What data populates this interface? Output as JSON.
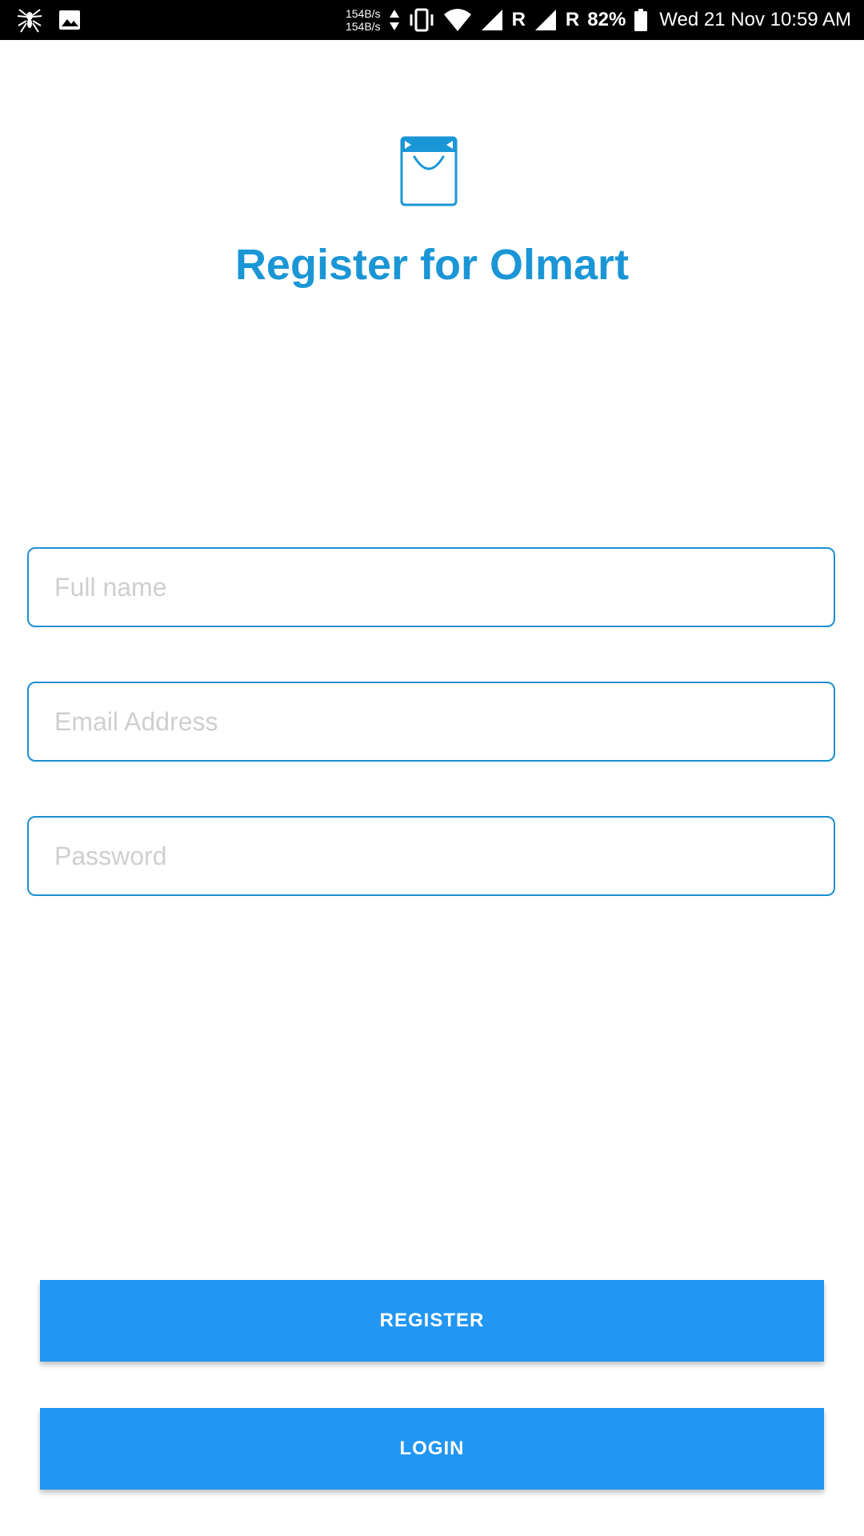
{
  "status_bar": {
    "net_up": "154B/s",
    "net_down": "154B/s",
    "roaming_1": "R",
    "roaming_2": "R",
    "battery": "82%",
    "datetime": "Wed 21 Nov 10:59 AM",
    "icons": [
      "spider-app-icon",
      "image-icon",
      "data-arrows-icon",
      "vibrate-icon",
      "wifi-icon",
      "signal-icon",
      "signal-icon",
      "battery-icon"
    ]
  },
  "header": {
    "title": "Register for Olmart",
    "logo_icon": "shopping-bag-icon"
  },
  "form": {
    "fullname_placeholder": "Full name",
    "email_placeholder": "Email Address",
    "password_placeholder": "Password"
  },
  "actions": {
    "register_label": "REGISTER",
    "login_label": "LOGIN"
  },
  "colors": {
    "accent": "#1a96d6",
    "field_border": "#1a8fd3",
    "button": "#2196f3",
    "placeholder": "#cfcfcf",
    "status_bar": "#000000"
  }
}
